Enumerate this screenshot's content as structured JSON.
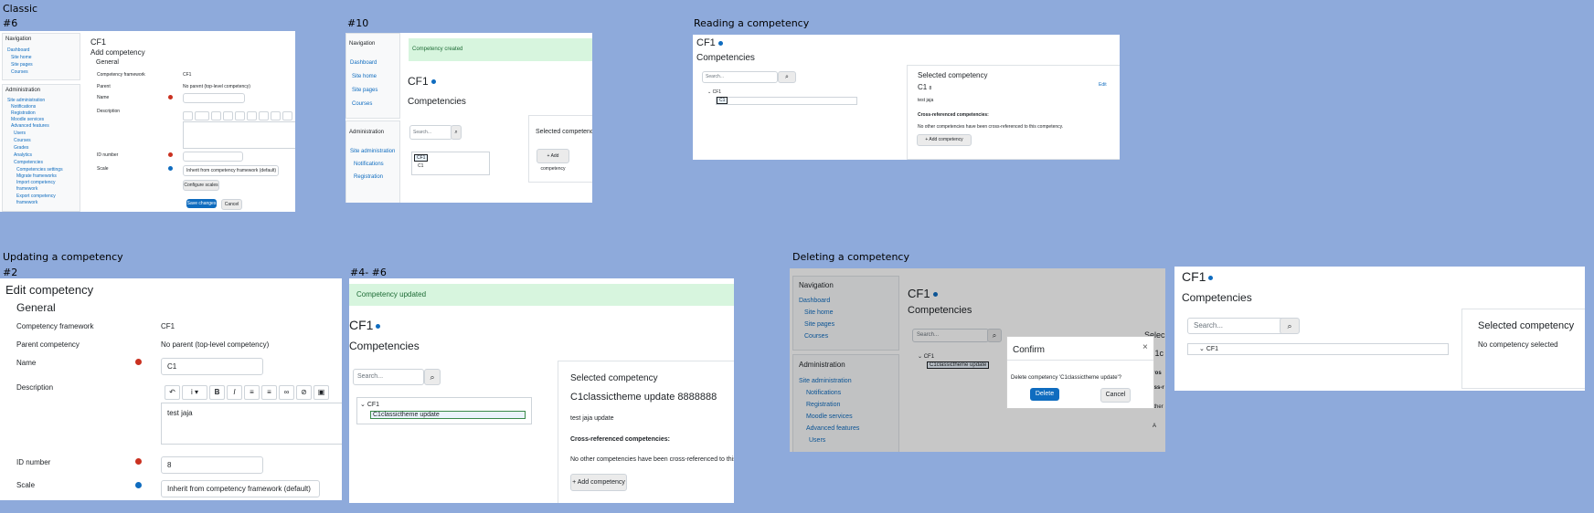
{
  "sections": {
    "classic": "Classic",
    "reading": "Reading a competency",
    "updating": "Updating a competency",
    "deleting": "Deleting a competency"
  },
  "tags": {
    "s6": "#6",
    "s10": "#10",
    "s2": "#2",
    "s4_6": "#4- #6"
  },
  "nav": {
    "navigation": "Navigation",
    "dashboard": "Dashboard",
    "site_home": "Site home",
    "site_pages": "Site pages",
    "courses": "Courses",
    "administration": "Administration",
    "site_admin": "Site administration",
    "notifications": "Notifications",
    "registration": "Registration",
    "moodle_services": "Moodle services",
    "advanced_features": "Advanced features",
    "users": "Users",
    "grades": "Grades",
    "analytics": "Analytics",
    "competencies": "Competencies",
    "comp_settings": "Competencies settings",
    "migrate": "Migrate frameworks",
    "import": "Import competency",
    "export": "Export competency",
    "framework": "framework"
  },
  "framework": {
    "name": "CF1",
    "competencies_title": "Competencies",
    "search_placeholder": "Search...",
    "tree_root": "CF1"
  },
  "form": {
    "add_title": "Add competency",
    "edit_title": "Edit competency",
    "general": "General",
    "framework_label": "Competency framework",
    "framework_value": "CF1",
    "parent_label": "Parent",
    "parent_label_full": "Parent competency",
    "parent_value": "No parent (top-level competency)",
    "name_label": "Name",
    "name_value": "C1",
    "description_label": "Description",
    "description_value": "test jaja",
    "id_label": "ID number",
    "id_value": "8",
    "scale_label": "Scale",
    "scale_value": "Inherit from competency framework (default)",
    "configure_scales": "Configure scales",
    "save": "Save changes",
    "cancel": "Cancel"
  },
  "messages": {
    "created": "Competency created",
    "updated": "Competency updated"
  },
  "competency": {
    "name": "C1",
    "id_tag": "8",
    "tree_item": "C1",
    "updated_name": "C1classictheme update",
    "updated_full": "C1classictheme update 8888888",
    "description": "test jaja",
    "description_updated": "test jaja update"
  },
  "selected": {
    "title": "Selected competency",
    "edit": "Edit",
    "cross_ref_title": "Cross-referenced competencies:",
    "cross_ref_none": "No other competencies have been cross-referenced to this competency.",
    "add_competency": "Add competency",
    "none_selected": "No competency selected"
  },
  "confirm": {
    "title": "Confirm",
    "close": "×",
    "message": "Delete competency 'C1classictheme update'?",
    "delete": "Delete",
    "cancel": "Cancel"
  },
  "partial": {
    "clc": "C1c",
    "cros": "Cros",
    "oss": "oss-r",
    "other": "other",
    "sel": "Selec",
    "a": "A"
  }
}
